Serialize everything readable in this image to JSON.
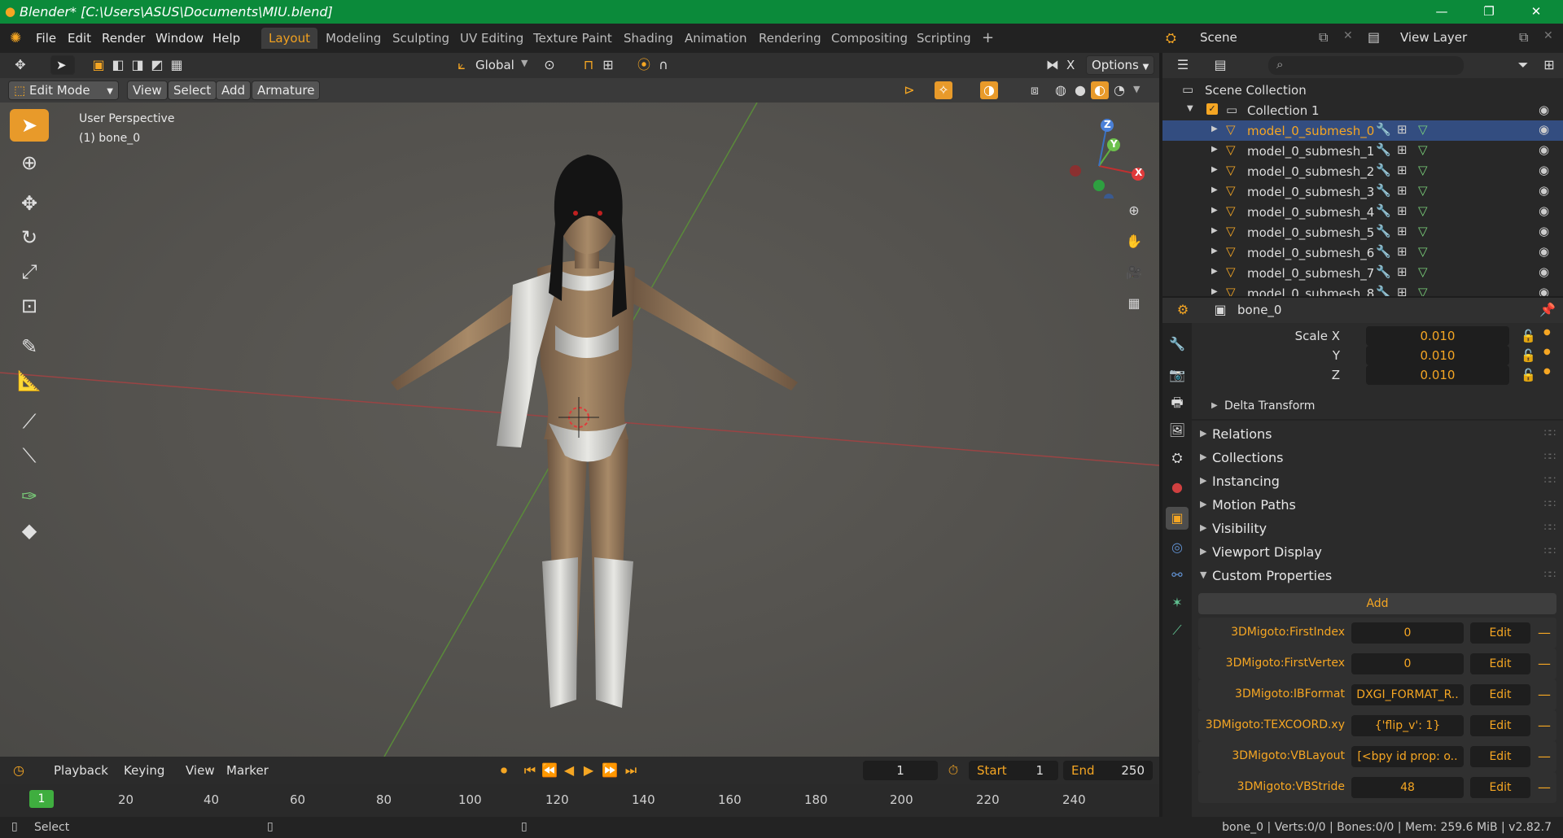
{
  "window": {
    "title": "Blender* [C:\\Users\\ASUS\\Documents\\MIU.blend]",
    "minimize": "—",
    "maximize": "❐",
    "close": "✕"
  },
  "menu": [
    "File",
    "Edit",
    "Render",
    "Window",
    "Help"
  ],
  "workspaces": [
    "Layout",
    "Modeling",
    "Sculpting",
    "UV Editing",
    "Texture Paint",
    "Shading",
    "Animation",
    "Rendering",
    "Compositing",
    "Scripting"
  ],
  "workspace_add": "+",
  "scene": {
    "label": "Scene",
    "view_layer": "View Layer"
  },
  "viewport_header": {
    "orientation": "Global",
    "options": "Options",
    "x_label": "X",
    "mode": "Edit Mode",
    "menus": [
      "View",
      "Select",
      "Add",
      "Armature"
    ]
  },
  "viewport": {
    "perspective": "User Perspective",
    "active": "(1) bone_0",
    "gizmo": {
      "x": "X",
      "y": "Y",
      "z": "Z"
    }
  },
  "timeline": {
    "menus": [
      "Playback",
      "Keying",
      "View",
      "Marker"
    ],
    "current_frame": "1",
    "start_label": "Start",
    "start": "1",
    "end_label": "End",
    "end": "250",
    "ticks": [
      "20",
      "40",
      "60",
      "80",
      "100",
      "120",
      "140",
      "160",
      "180",
      "200",
      "220",
      "240"
    ],
    "marker": "1"
  },
  "statusbar": {
    "select": "Select",
    "info": "bone_0 | Verts:0/0 | Bones:0/0 | Mem: 259.6 MiB | v2.82.7"
  },
  "outliner": {
    "root": "Scene Collection",
    "collection": "Collection 1",
    "items": [
      "model_0_submesh_0",
      "model_0_submesh_1",
      "model_0_submesh_2",
      "model_0_submesh_3",
      "model_0_submesh_4",
      "model_0_submesh_5",
      "model_0_submesh_6",
      "model_0_submesh_7",
      "model_0_submesh_8"
    ]
  },
  "properties": {
    "object_name": "bone_0",
    "scale": {
      "x_label": "Scale X",
      "y_label": "Y",
      "z_label": "Z",
      "x": "0.010",
      "y": "0.010",
      "z": "0.010"
    },
    "delta": "Delta Transform",
    "panels": [
      "Relations",
      "Collections",
      "Instancing",
      "Motion Paths",
      "Visibility",
      "Viewport Display"
    ],
    "custom_title": "Custom Properties",
    "add_label": "Add",
    "edit_label": "Edit",
    "custom": [
      {
        "key": "3DMigoto:FirstIndex",
        "value": "0"
      },
      {
        "key": "3DMigoto:FirstVertex",
        "value": "0"
      },
      {
        "key": "3DMigoto:IBFormat",
        "value": "DXGI_FORMAT_R.."
      },
      {
        "key": "3DMigoto:TEXCOORD.xy",
        "value": "{'flip_v': 1}"
      },
      {
        "key": "3DMigoto:VBLayout",
        "value": "[<bpy id prop: o.."
      },
      {
        "key": "3DMigoto:VBStride",
        "value": "48"
      }
    ]
  },
  "colors": {
    "accent": "#f5a623",
    "title_bar": "#0b8a3a",
    "selection": "#334d80"
  }
}
